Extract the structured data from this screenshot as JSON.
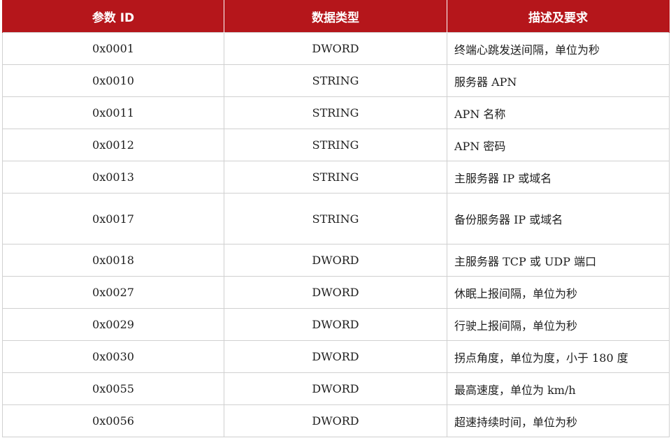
{
  "table": {
    "headers": [
      "参数 ID",
      "数据类型",
      "描述及要求"
    ],
    "rows": [
      {
        "id": "0x0001",
        "type": "DWORD",
        "desc": "终端心跳发送间隔，单位为秒"
      },
      {
        "id": "0x0010",
        "type": "STRING",
        "desc": "服务器 APN"
      },
      {
        "id": "0x0011",
        "type": "STRING",
        "desc": "APN 名称"
      },
      {
        "id": "0x0012",
        "type": "STRING",
        "desc": "APN 密码"
      },
      {
        "id": "0x0013",
        "type": "STRING",
        "desc": "主服务器 IP 或域名"
      },
      {
        "id": "0x0017",
        "type": "STRING",
        "desc": "备份服务器 IP 或域名"
      },
      {
        "id": "0x0018",
        "type": "DWORD",
        "desc": "主服务器 TCP 或 UDP 端口"
      },
      {
        "id": "0x0027",
        "type": "DWORD",
        "desc": "休眠上报间隔，单位为秒"
      },
      {
        "id": "0x0029",
        "type": "DWORD",
        "desc": "行驶上报间隔，单位为秒"
      },
      {
        "id": "0x0030",
        "type": "DWORD",
        "desc": "拐点角度，单位为度，小于 180 度"
      },
      {
        "id": "0x0055",
        "type": "DWORD",
        "desc": "最高速度，单位为 km/h"
      },
      {
        "id": "0x0056",
        "type": "DWORD",
        "desc": "超速持续时间，单位为秒"
      }
    ]
  },
  "colors": {
    "header_bg": "#b5161b",
    "header_text": "#ffffff",
    "grid": "#d0d0d0",
    "text": "#1e1e1e"
  }
}
